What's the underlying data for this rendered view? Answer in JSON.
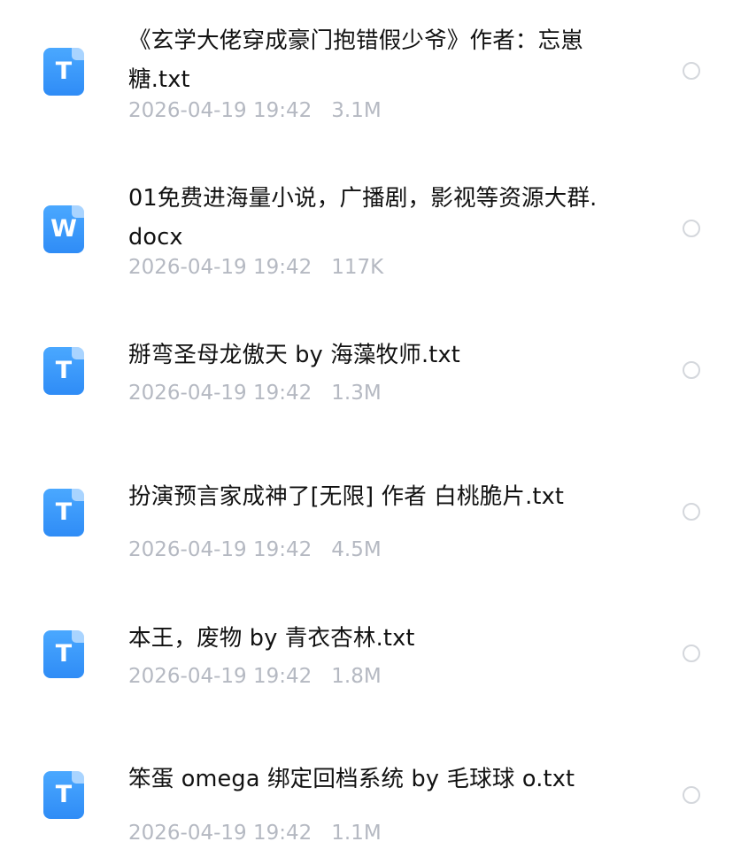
{
  "files": [
    {
      "icon_type": "txt-file-icon",
      "icon_letter": "T",
      "name": "《玄学大佬穿成豪门抱错假少爷》作者：忘崽糖.txt",
      "date": "2026-04-19 19:42",
      "size": "3.1M"
    },
    {
      "icon_type": "docx-file-icon",
      "icon_letter": "W",
      "name": "01免费进海量小说，广播剧，影视等资源大群.docx",
      "date": "2026-04-19 19:42",
      "size": "117K"
    },
    {
      "icon_type": "txt-file-icon",
      "icon_letter": "T",
      "name": "掰弯圣母龙傲天 by 海藻牧师.txt",
      "date": "2026-04-19 19:42",
      "size": "1.3M"
    },
    {
      "icon_type": "txt-file-icon",
      "icon_letter": "T",
      "name": "扮演预言家成神了[无限] 作者 白桃脆片.txt",
      "date": "2026-04-19 19:42",
      "size": "4.5M"
    },
    {
      "icon_type": "txt-file-icon",
      "icon_letter": "T",
      "name": "本王，废物 by 青衣杏林.txt",
      "date": "2026-04-19 19:42",
      "size": "1.8M"
    },
    {
      "icon_type": "txt-file-icon",
      "icon_letter": "T",
      "name": "笨蛋 omega 绑定回档系统 by 毛球球 o.txt",
      "date": "2026-04-19 19:42",
      "size": "1.1M"
    }
  ]
}
